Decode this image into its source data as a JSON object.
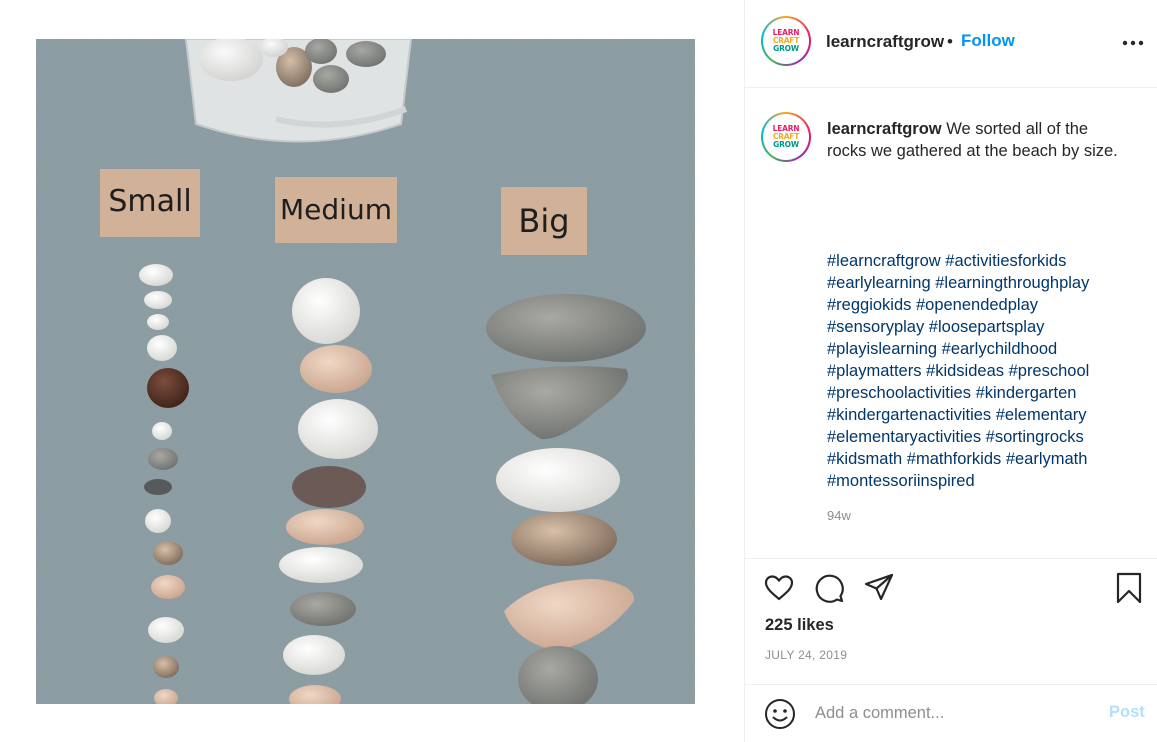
{
  "post": {
    "username": "learncraftgrow",
    "avatar_text": [
      "LEARN",
      "CRAFT",
      "GROW"
    ],
    "header_separator": "•",
    "follow_label": "Follow",
    "caption_text": "We sorted all of the rocks we gathered at the beach by size.",
    "hashtag_lines": [
      "#learncraftgrow #activitiesforkids",
      "#earlylearning #learningthroughplay",
      "#reggiokids #openendedplay",
      "#sensoryplay #loosepartsplay",
      "#playislearning #earlychildhood",
      "#playmatters #kidsideas #preschool",
      "#preschoolactivities #kindergarten",
      "#kindergartenactivities #elementary",
      "#elementaryactivities #sortingrocks",
      "#kidsmath #mathforkids #earlymath",
      "#montessoriinspired"
    ],
    "time_ago": "94w",
    "likes": "225 likes",
    "date": "JULY 24, 2019"
  },
  "photo": {
    "labels": [
      "Small",
      "Medium",
      "Big"
    ]
  },
  "comment_box": {
    "placeholder": "Add a comment...",
    "post_label": "Post"
  },
  "icons": {
    "more": "more-options-icon",
    "like": "heart-icon",
    "comment": "comment-icon",
    "share": "share-icon",
    "save": "bookmark-icon",
    "emoji": "emoji-icon"
  },
  "colors": {
    "link_blue": "#0095f6",
    "hashtag": "#00376b",
    "muted": "#8e8e8e",
    "post_disabled": "#b2dffc"
  }
}
